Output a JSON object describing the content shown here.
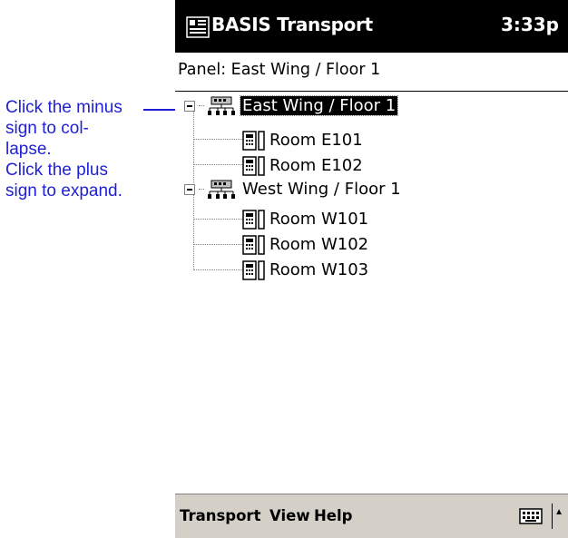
{
  "callout": {
    "lines": [
      "Click the minus",
      "sign to col-",
      "lapse.",
      "Click the plus",
      "sign to expand."
    ]
  },
  "app": {
    "title": "BASIS Transport",
    "clock": "3:33p"
  },
  "panel": {
    "text": "Panel: East Wing / Floor 1"
  },
  "tree": {
    "groups": [
      {
        "label": "East Wing / Floor 1",
        "selected": true,
        "rooms": [
          "Room E101",
          "Room E102"
        ]
      },
      {
        "label": "West Wing / Floor 1",
        "selected": false,
        "rooms": [
          "Room W101",
          "Room W102",
          "Room W103"
        ]
      }
    ]
  },
  "menubar": {
    "items": [
      "Transport",
      "View",
      "Help"
    ]
  },
  "icons": {
    "title": "app-logo-icon",
    "group": "network-panel-icon",
    "room": "room-device-icon",
    "keyboard": "keyboard-icon",
    "expander": "minus-box-icon",
    "sip": "up-arrow-icon"
  }
}
